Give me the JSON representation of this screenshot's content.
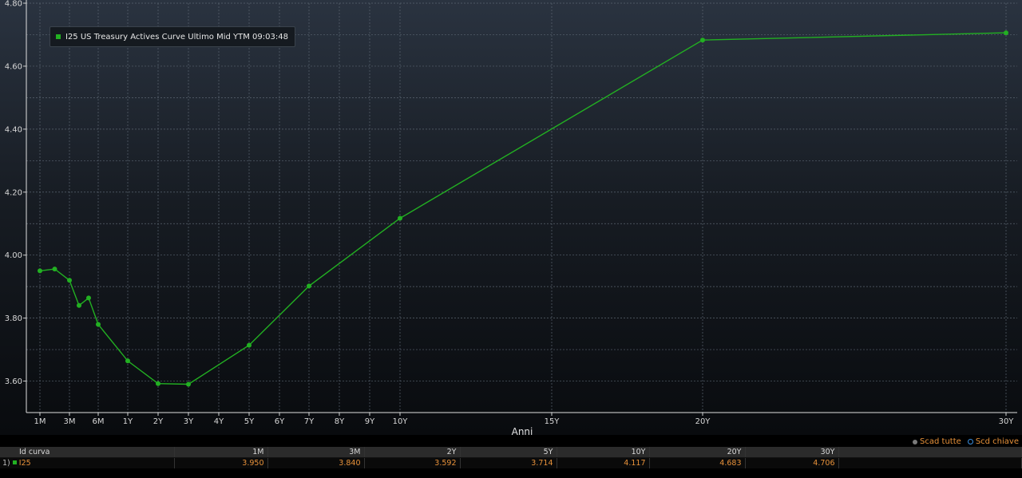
{
  "chart_data": {
    "type": "line",
    "title": "",
    "xlabel": "Anni",
    "ylabel": "",
    "ylim": [
      3.5,
      4.8
    ],
    "yticks": [
      3.6,
      3.8,
      4.0,
      4.2,
      4.4,
      4.6,
      4.8
    ],
    "ytick_labels": [
      "3.60",
      "3.80",
      "4.00",
      "4.20",
      "4.40",
      "4.60",
      "4.80"
    ],
    "xlim_years": [
      0,
      30.8
    ],
    "xticks": [
      {
        "label": "1M",
        "years": 0.0833
      },
      {
        "label": "3M",
        "years": 1
      },
      {
        "label": "6M",
        "years": 2
      },
      {
        "label": "1Y",
        "years": 3
      },
      {
        "label": "2Y",
        "years": 4
      },
      {
        "label": "3Y",
        "years": 5
      },
      {
        "label": "4Y",
        "years": 6
      },
      {
        "label": "5Y",
        "years": 7
      },
      {
        "label": "6Y",
        "years": 8
      },
      {
        "label": "7Y",
        "years": 9
      },
      {
        "label": "8Y",
        "years": 10
      },
      {
        "label": "9Y",
        "years": 11
      },
      {
        "label": "10Y",
        "years": 12
      },
      {
        "label": "15Y",
        "years": 17
      },
      {
        "label": "20Y",
        "years": 22
      },
      {
        "label": "30Y",
        "years": 32
      }
    ],
    "grid": true,
    "series": [
      {
        "name": "I25 US Treasury Actives Curve Ultimo Mid YTM 09:03:48",
        "color": "#22b022",
        "points": [
          {
            "x": "1M",
            "y": 3.95
          },
          {
            "x": "2M",
            "y": 3.956
          },
          {
            "x": "3M",
            "y": 3.92
          },
          {
            "x": "4M",
            "y": 3.84
          },
          {
            "x": "5M",
            "y": 3.864
          },
          {
            "x": "6M",
            "y": 3.78
          },
          {
            "x": "1Y",
            "y": 3.664
          },
          {
            "x": "2Y",
            "y": 3.592
          },
          {
            "x": "3Y",
            "y": 3.59
          },
          {
            "x": "5Y",
            "y": 3.714
          },
          {
            "x": "7Y",
            "y": 3.902
          },
          {
            "x": "10Y",
            "y": 4.117
          },
          {
            "x": "20Y",
            "y": 4.683
          },
          {
            "x": "30Y",
            "y": 4.706
          }
        ]
      }
    ],
    "legend": "top-left"
  },
  "legend": {
    "text": "I25 US Treasury Actives Curve Ultimo Mid YTM 09:03:48",
    "color": "#22b022"
  },
  "controls": {
    "scad_tutte": "Scad tutte",
    "scd_chiave": "Scd chiave"
  },
  "table": {
    "header": {
      "id_label": "Id curva",
      "columns": [
        "1M",
        "3M",
        "2Y",
        "5Y",
        "10Y",
        "20Y",
        "30Y"
      ]
    },
    "row": {
      "row_num": "1)",
      "name": "I25",
      "values": [
        "3.950",
        "3.840",
        "3.592",
        "3.714",
        "4.117",
        "4.683",
        "4.706"
      ]
    }
  }
}
